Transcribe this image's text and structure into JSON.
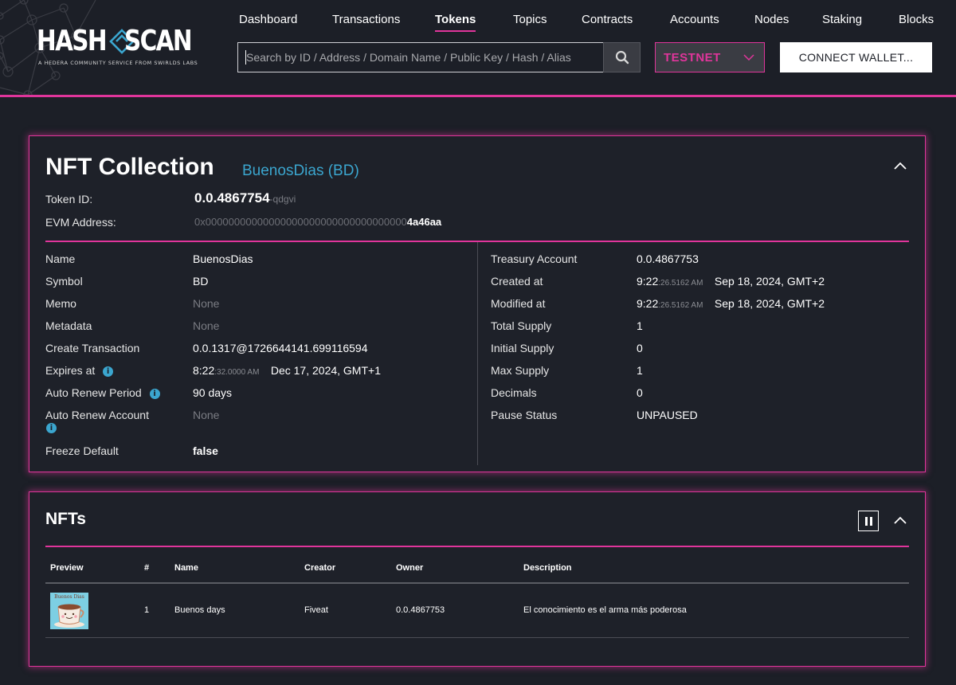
{
  "app": {
    "logo_left": "HASH",
    "logo_right": "SCAN",
    "logo_tagline": "A HEDERA COMMUNITY SERVICE FROM SWIRLDS LABS"
  },
  "nav": {
    "items": [
      {
        "label": "Dashboard",
        "active": false
      },
      {
        "label": "Transactions",
        "active": false
      },
      {
        "label": "Tokens",
        "active": true
      },
      {
        "label": "Topics",
        "active": false
      },
      {
        "label": "Contracts",
        "active": false
      },
      {
        "label": "Accounts",
        "active": false
      },
      {
        "label": "Nodes",
        "active": false
      },
      {
        "label": "Staking",
        "active": false
      },
      {
        "label": "Blocks",
        "active": false
      }
    ]
  },
  "search": {
    "placeholder": "Search by ID / Address / Domain Name / Public Key / Hash / Alias",
    "value": ""
  },
  "network": {
    "selected": "TESTNET"
  },
  "wallet": {
    "connect_label": "CONNECT WALLET..."
  },
  "collection": {
    "title": "NFT Collection",
    "subtitle": "BuenosDias (BD)",
    "token_id_label": "Token ID:",
    "token_id": "0.0.4867754",
    "token_id_checksum": "-qdgvi",
    "evm_label": "EVM Address:",
    "evm_prefix": "0x00000000000000000000000000000000000",
    "evm_suffix": "4a46aa",
    "left": {
      "name_label": "Name",
      "name": "BuenosDias",
      "symbol_label": "Symbol",
      "symbol": "BD",
      "memo_label": "Memo",
      "memo": "None",
      "metadata_label": "Metadata",
      "metadata": "None",
      "create_tx_label": "Create Transaction",
      "create_tx": "0.0.1317@1726644141.699116594",
      "expires_label": "Expires at",
      "expires_time": "8:22",
      "expires_frac": ":32.0000 AM",
      "expires_date": "Dec 17, 2024, GMT+1",
      "auto_renew_period_label": "Auto Renew Period",
      "auto_renew_period": "90 days",
      "auto_renew_account_label": "Auto Renew Account",
      "auto_renew_account": "None",
      "freeze_default_label": "Freeze Default",
      "freeze_default": "false"
    },
    "right": {
      "treasury_label": "Treasury Account",
      "treasury": "0.0.4867753",
      "created_label": "Created at",
      "created_time": "9:22",
      "created_frac": ":26.5162 AM",
      "created_date": "Sep 18, 2024, GMT+2",
      "modified_label": "Modified at",
      "modified_time": "9:22",
      "modified_frac": ":26.5162 AM",
      "modified_date": "Sep 18, 2024, GMT+2",
      "total_supply_label": "Total Supply",
      "total_supply": "1",
      "initial_supply_label": "Initial Supply",
      "initial_supply": "0",
      "max_supply_label": "Max Supply",
      "max_supply": "1",
      "decimals_label": "Decimals",
      "decimals": "0",
      "pause_status_label": "Pause Status",
      "pause_status": "UNPAUSED"
    }
  },
  "nfts": {
    "title": "NFTs",
    "columns": [
      "Preview",
      "#",
      "Name",
      "Creator",
      "Owner",
      "Description"
    ],
    "rows": [
      {
        "serial": "1",
        "name": "Buenos days",
        "creator": "Fiveat",
        "owner": "0.0.4867753",
        "description": "El conocimiento es el arma más poderosa",
        "thumb_caption": "Buenos Dias"
      }
    ]
  },
  "colors": {
    "accent": "#e0359b",
    "link": "#3ba6cf",
    "background": "#1c1f27"
  }
}
